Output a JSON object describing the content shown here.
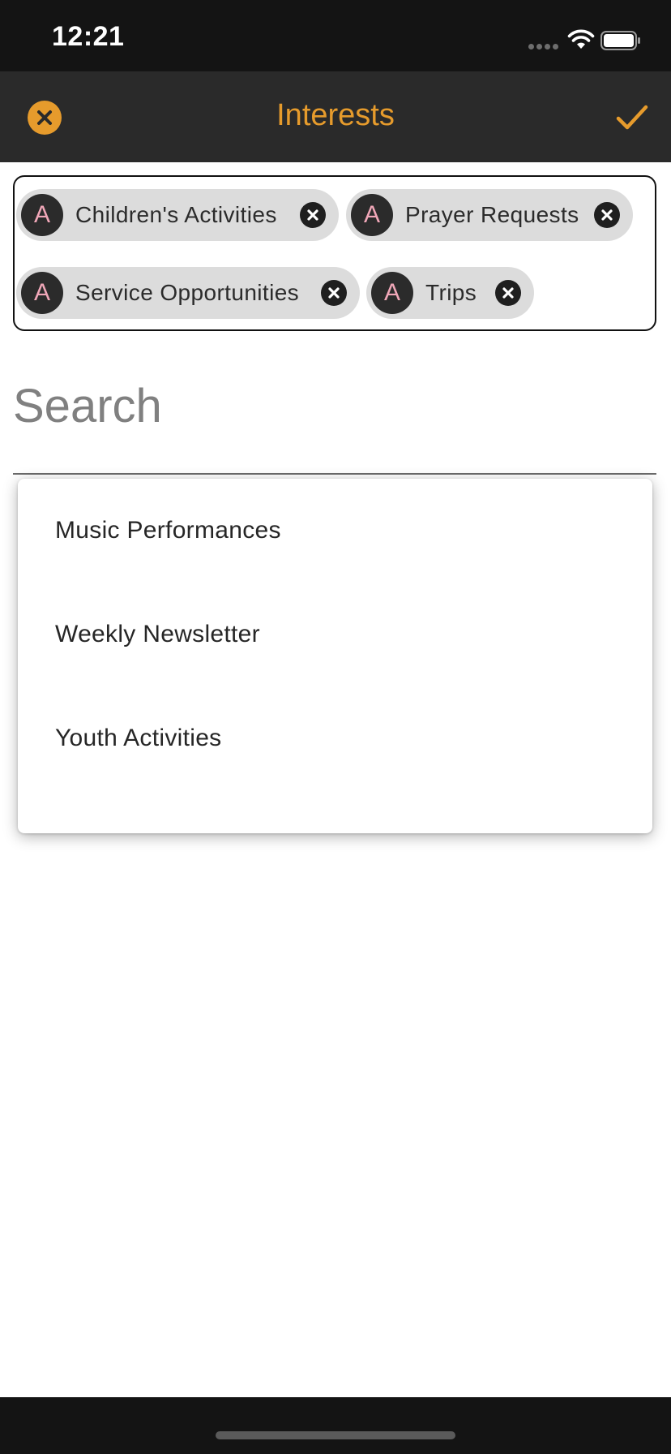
{
  "status_bar": {
    "time": "12:21"
  },
  "header": {
    "title": "Interests",
    "close_icon": "close-circle-icon",
    "confirm_icon": "checkmark-icon",
    "accent_color": "#e69b2c"
  },
  "selected_chips": [
    {
      "avatar": "A",
      "label": "Children's Activities"
    },
    {
      "avatar": "A",
      "label": "Prayer Requests"
    },
    {
      "avatar": "A",
      "label": "Service Opportunities"
    },
    {
      "avatar": "A",
      "label": "Trips"
    }
  ],
  "search": {
    "placeholder": "Search",
    "value": ""
  },
  "suggestions": [
    {
      "label": "Music Performances"
    },
    {
      "label": "Weekly Newsletter"
    },
    {
      "label": "Youth Activities"
    }
  ]
}
